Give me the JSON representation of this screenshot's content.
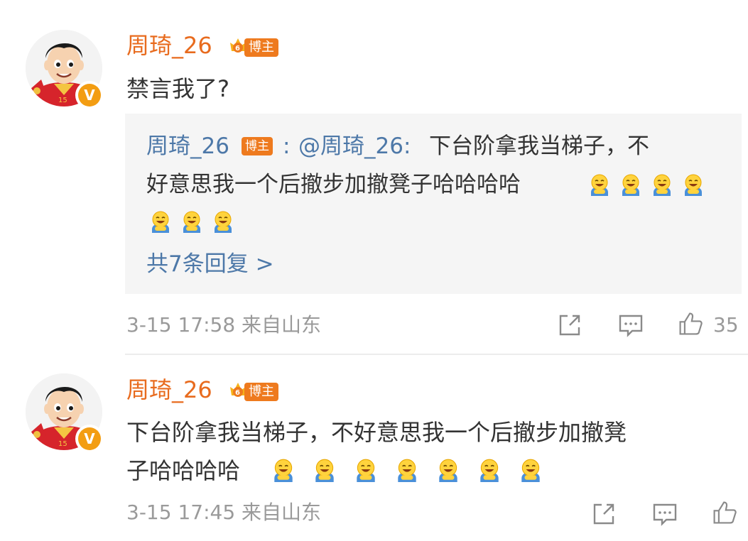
{
  "comments": [
    {
      "username": "周琦_26",
      "badge": "博主",
      "verified_mark": "V",
      "text": "禁言我了?",
      "quote": {
        "username": "周琦_26",
        "badge": "博主",
        "colon": ":",
        "mention": "@周琦_26:",
        "line1": "下台阶拿我当梯子，不",
        "line2": "好意思我一个后撤步加撤凳子哈哈哈哈",
        "replies_link": "共7条回复 >"
      },
      "timestamp": "3-15 17:58",
      "location": "来自山东",
      "like_count": "35"
    },
    {
      "username": "周琦_26",
      "badge": "博主",
      "verified_mark": "V",
      "text_line1": "下台阶拿我当梯子，不好意思我一个后撤步加撤凳",
      "text_line2": "子哈哈哈哈",
      "timestamp": "3-15 17:45",
      "location": "来自山东"
    }
  ],
  "icons": {
    "emoji": "laughing-face-emoji",
    "share": "share-icon",
    "reply": "comment-icon",
    "like": "thumbs-up-icon",
    "crown": "crown-badge-icon"
  },
  "colors": {
    "username": "#e86b1e",
    "link": "#4d78a8",
    "badge": "#ee7a1e",
    "meta": "#9a9a9a",
    "verified": "#f39d12"
  }
}
